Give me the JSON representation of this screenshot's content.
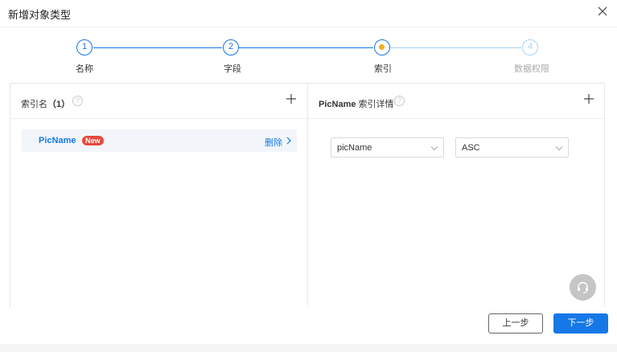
{
  "dialog": {
    "title": "新增对象类型"
  },
  "steps": [
    {
      "number": "1",
      "label": "名称",
      "status": "done"
    },
    {
      "number": "2",
      "label": "字段",
      "status": "done"
    },
    {
      "number": "",
      "label": "索引",
      "status": "current"
    },
    {
      "number": "4",
      "label": "数据权限",
      "status": "pending"
    }
  ],
  "left_panel": {
    "title": "索引名",
    "count": "（1）",
    "items": [
      {
        "name": "PicName",
        "badge": "New",
        "action": "删除"
      }
    ]
  },
  "right_panel": {
    "title_name": "PicName",
    "title_suffix": " 索引详情",
    "field_select": {
      "value": "picName"
    },
    "order_select": {
      "value": "ASC"
    }
  },
  "footer": {
    "prev_label": "上一步",
    "next_label": "下一步"
  },
  "colors": {
    "primary": "#1677e6",
    "current_dot": "#f2b01e",
    "badge": "#e8483d",
    "pending": "#a9d2f5"
  },
  "icons": [
    "close-icon",
    "help-icon",
    "plus-icon",
    "chevron-right-icon",
    "chevron-down-icon",
    "headset-icon"
  ]
}
